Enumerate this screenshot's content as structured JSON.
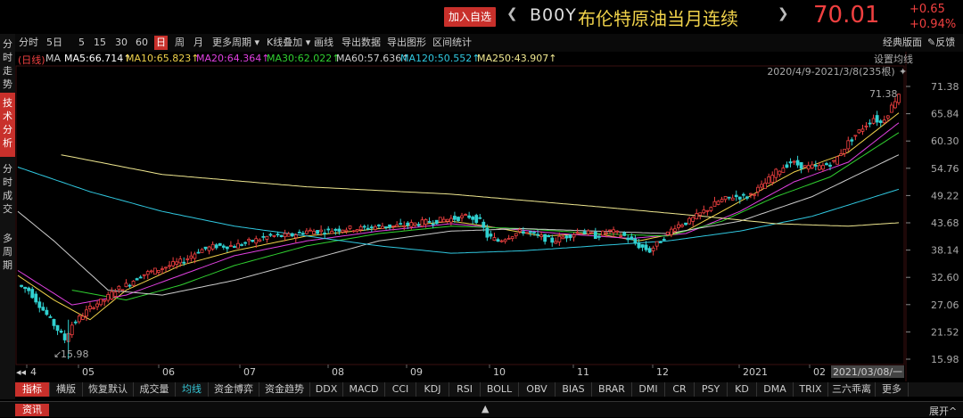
{
  "header": {
    "add_button": "加入自选",
    "code": "B00Y",
    "name": "布伦特原油当月连续",
    "price": "70.01",
    "change": "+0.65",
    "change_pct": "+0.94%"
  },
  "sidebar": {
    "tabs": [
      "分时走势",
      "技术分析",
      "分时成交",
      "多周期"
    ]
  },
  "toolbar": {
    "items": [
      "分时",
      "5日",
      "5",
      "15",
      "30",
      "60",
      "日",
      "周",
      "月",
      "更多周期",
      "K线叠加",
      "画线",
      "导出数据",
      "导出图形",
      "区间统计"
    ],
    "active": "日",
    "right_items": [
      "经典版面",
      "反馈"
    ]
  },
  "ma_line": {
    "prefix": "(日线)",
    "label": "MA",
    "items": [
      {
        "text": "MA5:66.714↑",
        "color": "#ffffff"
      },
      {
        "text": "MA10:65.823↑",
        "color": "#f0d24a"
      },
      {
        "text": "MA20:64.364↑",
        "color": "#e040e0"
      },
      {
        "text": "MA30:62.022↑",
        "color": "#30d030"
      },
      {
        "text": "MA60:57.636↑",
        "color": "#cccccc"
      },
      {
        "text": "MA120:50.552↑",
        "color": "#30c8e0"
      },
      {
        "text": "MA250:43.907↑",
        "color": "#f0e890"
      }
    ]
  },
  "chart_meta": {
    "settings": "设置均线",
    "range": "2020/4/9-2021/3/8(235根)",
    "max_label": "71.38",
    "min_label": "15.98",
    "cursor_date": "2021/03/08/一"
  },
  "chart_data": {
    "type": "candlestick",
    "y_ticks": [
      71.38,
      65.84,
      60.3,
      54.76,
      49.22,
      43.68,
      38.14,
      32.6,
      27.06,
      21.52,
      15.98
    ],
    "ylim": [
      15.98,
      71.38
    ],
    "x_ticks": [
      "4",
      "05",
      "06",
      "07",
      "08",
      "09",
      "10",
      "11",
      "12",
      "2021",
      "02"
    ],
    "close_path": [
      [
        0,
        31
      ],
      [
        3,
        30
      ],
      [
        6,
        27
      ],
      [
        9,
        24
      ],
      [
        11,
        22
      ],
      [
        13,
        20
      ],
      [
        15,
        23
      ],
      [
        18,
        25
      ],
      [
        21,
        27
      ],
      [
        24,
        28
      ],
      [
        27,
        30
      ],
      [
        30,
        31
      ],
      [
        34,
        33
      ],
      [
        38,
        34
      ],
      [
        42,
        35
      ],
      [
        46,
        36
      ],
      [
        50,
        38
      ],
      [
        55,
        39
      ],
      [
        60,
        39
      ],
      [
        65,
        40
      ],
      [
        70,
        41
      ],
      [
        75,
        41
      ],
      [
        80,
        42
      ],
      [
        85,
        42
      ],
      [
        90,
        42.5
      ],
      [
        95,
        42.5
      ],
      [
        100,
        43
      ],
      [
        105,
        43
      ],
      [
        110,
        43.5
      ],
      [
        115,
        44
      ],
      [
        120,
        44.5
      ],
      [
        125,
        45
      ],
      [
        128,
        44
      ],
      [
        130,
        41
      ],
      [
        133,
        40
      ],
      [
        136,
        41
      ],
      [
        140,
        42
      ],
      [
        144,
        41
      ],
      [
        148,
        40
      ],
      [
        152,
        41
      ],
      [
        156,
        42
      ],
      [
        160,
        41
      ],
      [
        164,
        42
      ],
      [
        168,
        41
      ],
      [
        172,
        39
      ],
      [
        175,
        38
      ],
      [
        178,
        40
      ],
      [
        182,
        43
      ],
      [
        186,
        44
      ],
      [
        190,
        46
      ],
      [
        194,
        48
      ],
      [
        198,
        49
      ],
      [
        202,
        49
      ],
      [
        206,
        51
      ],
      [
        210,
        54
      ],
      [
        214,
        56
      ],
      [
        218,
        55
      ],
      [
        222,
        55
      ],
      [
        226,
        56
      ],
      [
        230,
        60
      ],
      [
        234,
        63
      ],
      [
        237,
        65
      ],
      [
        239,
        64
      ],
      [
        241,
        66
      ],
      [
        244,
        70
      ]
    ],
    "ma_lines": [
      {
        "name": "MA10",
        "color": "#f0d24a",
        "points": [
          [
            0,
            33
          ],
          [
            10,
            28
          ],
          [
            20,
            24
          ],
          [
            30,
            30
          ],
          [
            45,
            35
          ],
          [
            60,
            38
          ],
          [
            80,
            41
          ],
          [
            100,
            42.5
          ],
          [
            120,
            44
          ],
          [
            130,
            43
          ],
          [
            145,
            41
          ],
          [
            160,
            41.5
          ],
          [
            172,
            40
          ],
          [
            185,
            42
          ],
          [
            200,
            48
          ],
          [
            215,
            54
          ],
          [
            230,
            58
          ],
          [
            244,
            66
          ]
        ]
      },
      {
        "name": "MA20",
        "color": "#e040e0",
        "points": [
          [
            0,
            34
          ],
          [
            15,
            27
          ],
          [
            30,
            29
          ],
          [
            45,
            33
          ],
          [
            60,
            37
          ],
          [
            80,
            40
          ],
          [
            100,
            42
          ],
          [
            120,
            43.5
          ],
          [
            135,
            42.5
          ],
          [
            150,
            41.5
          ],
          [
            170,
            40.5
          ],
          [
            185,
            41.5
          ],
          [
            200,
            46
          ],
          [
            215,
            52
          ],
          [
            230,
            56
          ],
          [
            244,
            64
          ]
        ]
      },
      {
        "name": "MA30",
        "color": "#30d030",
        "points": [
          [
            15,
            30
          ],
          [
            30,
            28
          ],
          [
            45,
            31
          ],
          [
            60,
            35
          ],
          [
            80,
            39
          ],
          [
            100,
            41.5
          ],
          [
            120,
            43
          ],
          [
            140,
            42.5
          ],
          [
            160,
            41.5
          ],
          [
            180,
            41
          ],
          [
            195,
            44
          ],
          [
            210,
            49
          ],
          [
            225,
            53
          ],
          [
            244,
            62
          ]
        ]
      },
      {
        "name": "MA60",
        "color": "#cccccc",
        "points": [
          [
            0,
            46
          ],
          [
            10,
            40
          ],
          [
            25,
            30
          ],
          [
            40,
            29
          ],
          [
            60,
            32
          ],
          [
            80,
            36
          ],
          [
            100,
            40
          ],
          [
            120,
            42
          ],
          [
            140,
            42.5
          ],
          [
            160,
            42
          ],
          [
            180,
            41.5
          ],
          [
            200,
            44
          ],
          [
            220,
            49
          ],
          [
            244,
            57.5
          ]
        ]
      },
      {
        "name": "MA120",
        "color": "#30c8e0",
        "points": [
          [
            0,
            55
          ],
          [
            20,
            50
          ],
          [
            40,
            46
          ],
          [
            60,
            43
          ],
          [
            80,
            41
          ],
          [
            100,
            39
          ],
          [
            120,
            37.5
          ],
          [
            140,
            38
          ],
          [
            160,
            39
          ],
          [
            180,
            40
          ],
          [
            200,
            42
          ],
          [
            220,
            45
          ],
          [
            244,
            50.5
          ]
        ]
      },
      {
        "name": "MA250",
        "color": "#f0e890",
        "points": [
          [
            12,
            57.5
          ],
          [
            40,
            53.5
          ],
          [
            80,
            51
          ],
          [
            120,
            49.5
          ],
          [
            160,
            47
          ],
          [
            190,
            45
          ],
          [
            210,
            43.5
          ],
          [
            230,
            43
          ],
          [
            244,
            43.7
          ]
        ]
      }
    ]
  },
  "indicator_tabs": [
    "指标",
    "横版",
    "恢复默认",
    "成交量",
    "均线",
    "资金博弈",
    "资金趋势",
    "DDX",
    "MACD",
    "CCI",
    "KDJ",
    "RSI",
    "BOLL",
    "OBV",
    "BIAS",
    "BRAR",
    "DMI",
    "CR",
    "PSY",
    "KD",
    "DMA",
    "TRIX",
    "三六乖离",
    "更多"
  ],
  "indicator_active": "指标",
  "indicator_highlight": "均线",
  "infobar": {
    "info_button": "资讯",
    "expand": "展开"
  },
  "colors": {
    "up": "#f04040",
    "down": "#30d0d0",
    "accent": "#c8302b"
  }
}
